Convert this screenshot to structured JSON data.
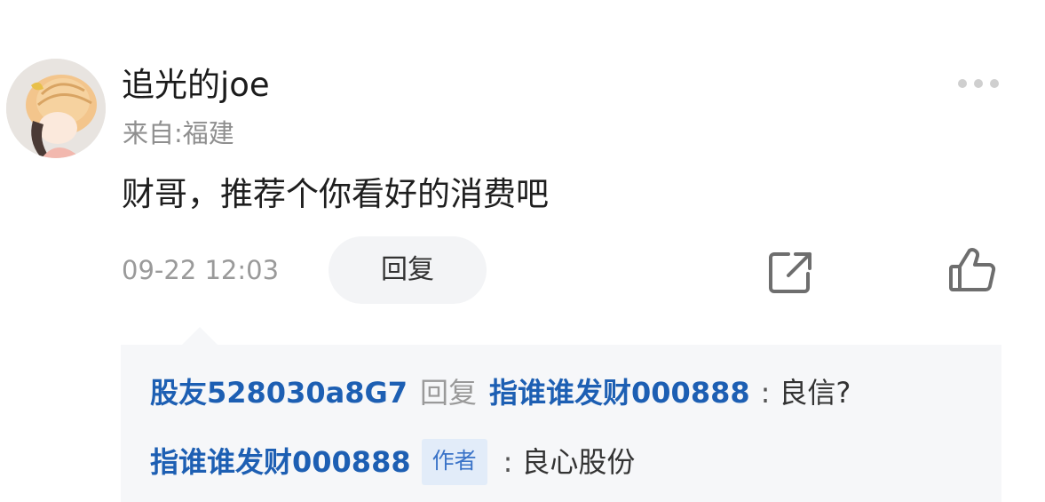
{
  "comment": {
    "username": "追光的joe",
    "location": "来自:福建",
    "text": "财哥，推荐个你看好的消费吧",
    "timestamp": "09-22 12:03",
    "reply_button_label": "回复"
  },
  "replies": [
    {
      "from": "股友528030a8G7",
      "connector": "回复",
      "to": "指谁谁发财000888",
      "separator": ":",
      "text": "良信?"
    },
    {
      "from": "指谁谁发财000888",
      "badge": "作者",
      "separator": ":",
      "text": "良心股份"
    }
  ],
  "icons": {
    "more": "more-dots-icon",
    "share": "share-icon",
    "like": "thumbs-up-icon",
    "avatar": "avatar-illustration"
  },
  "colors": {
    "link_blue": "#1d5fb3",
    "badge_bg": "#e2ecf9",
    "reply_box_bg": "#f6f7f9",
    "muted_text": "#9a9a9a"
  }
}
